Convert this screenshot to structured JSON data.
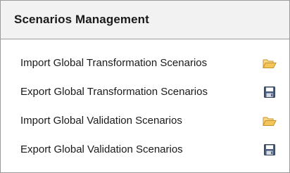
{
  "panel": {
    "title": "Scenarios Management",
    "items": [
      {
        "label": "Import Global Transformation Scenarios",
        "icon": "folder-open-icon"
      },
      {
        "label": "Export Global Transformation Scenarios",
        "icon": "floppy-disk-icon"
      },
      {
        "label": "Import Global Validation Scenarios",
        "icon": "folder-open-icon"
      },
      {
        "label": "Export Global Validation Scenarios",
        "icon": "floppy-disk-icon"
      }
    ]
  },
  "colors": {
    "header_background": "#f2f2f2",
    "border": "#9a9a9a",
    "folder": "#f4c65a",
    "floppy": "#4a5d7e"
  }
}
